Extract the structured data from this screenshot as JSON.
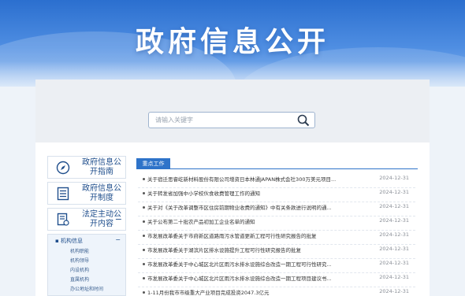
{
  "header": {
    "title": "政府信息公开"
  },
  "search": {
    "placeholder": "请输入关键字"
  },
  "sidebar": {
    "items": [
      {
        "label": "政府信息公开指南"
      },
      {
        "label": "政府信息公开制度"
      },
      {
        "label": "法定主动公开内容"
      }
    ],
    "sub_head": "机构信息",
    "sub_items": [
      "机构职能",
      "机构领导",
      "内设机构",
      "直属机构",
      "办公地址和时间"
    ]
  },
  "news": {
    "tab_label": "重点工作",
    "rows": [
      {
        "title": "关于宿迁思睿屹新材料股份有限公司增资日本林通JAPAN株式会社300万美元项目...",
        "date": "2024-12-31"
      },
      {
        "title": "关于转发省加强中小学校伙食收费管理工作的通知",
        "date": "2024-12-31"
      },
      {
        "title": "关于对《关于改革调整市区住房前期物业收费的通知》中有关条款进行说明的通...",
        "date": "2024-12-31"
      },
      {
        "title": "关于公布第二十批农产品初加工企业名单的通知",
        "date": "2024-12-31"
      },
      {
        "title": "市发展改革委关于市府新区道路雨污水管道更新工程可行性研究报告的批复",
        "date": "2024-12-31"
      },
      {
        "title": "市发展改革委关于湖滨片区排水设施提升工程可行性研究报告的批复",
        "date": "2024-12-31"
      },
      {
        "title": "市发展改革委关于中心城区北片区雨污水排水设施综合改造一期工程可行性研究...",
        "date": "2024-12-31"
      },
      {
        "title": "市发展改革委关于中心城区北片区雨污水排水设施综合改造一期工程项目建议书...",
        "date": "2024-12-31"
      },
      {
        "title": "1-11月份我市市级重大产业项目完成投资2047.3亿元",
        "date": "2024-12-31"
      }
    ]
  },
  "colors": {
    "accent": "#2e73c9",
    "banner": "#4f8ee2"
  }
}
